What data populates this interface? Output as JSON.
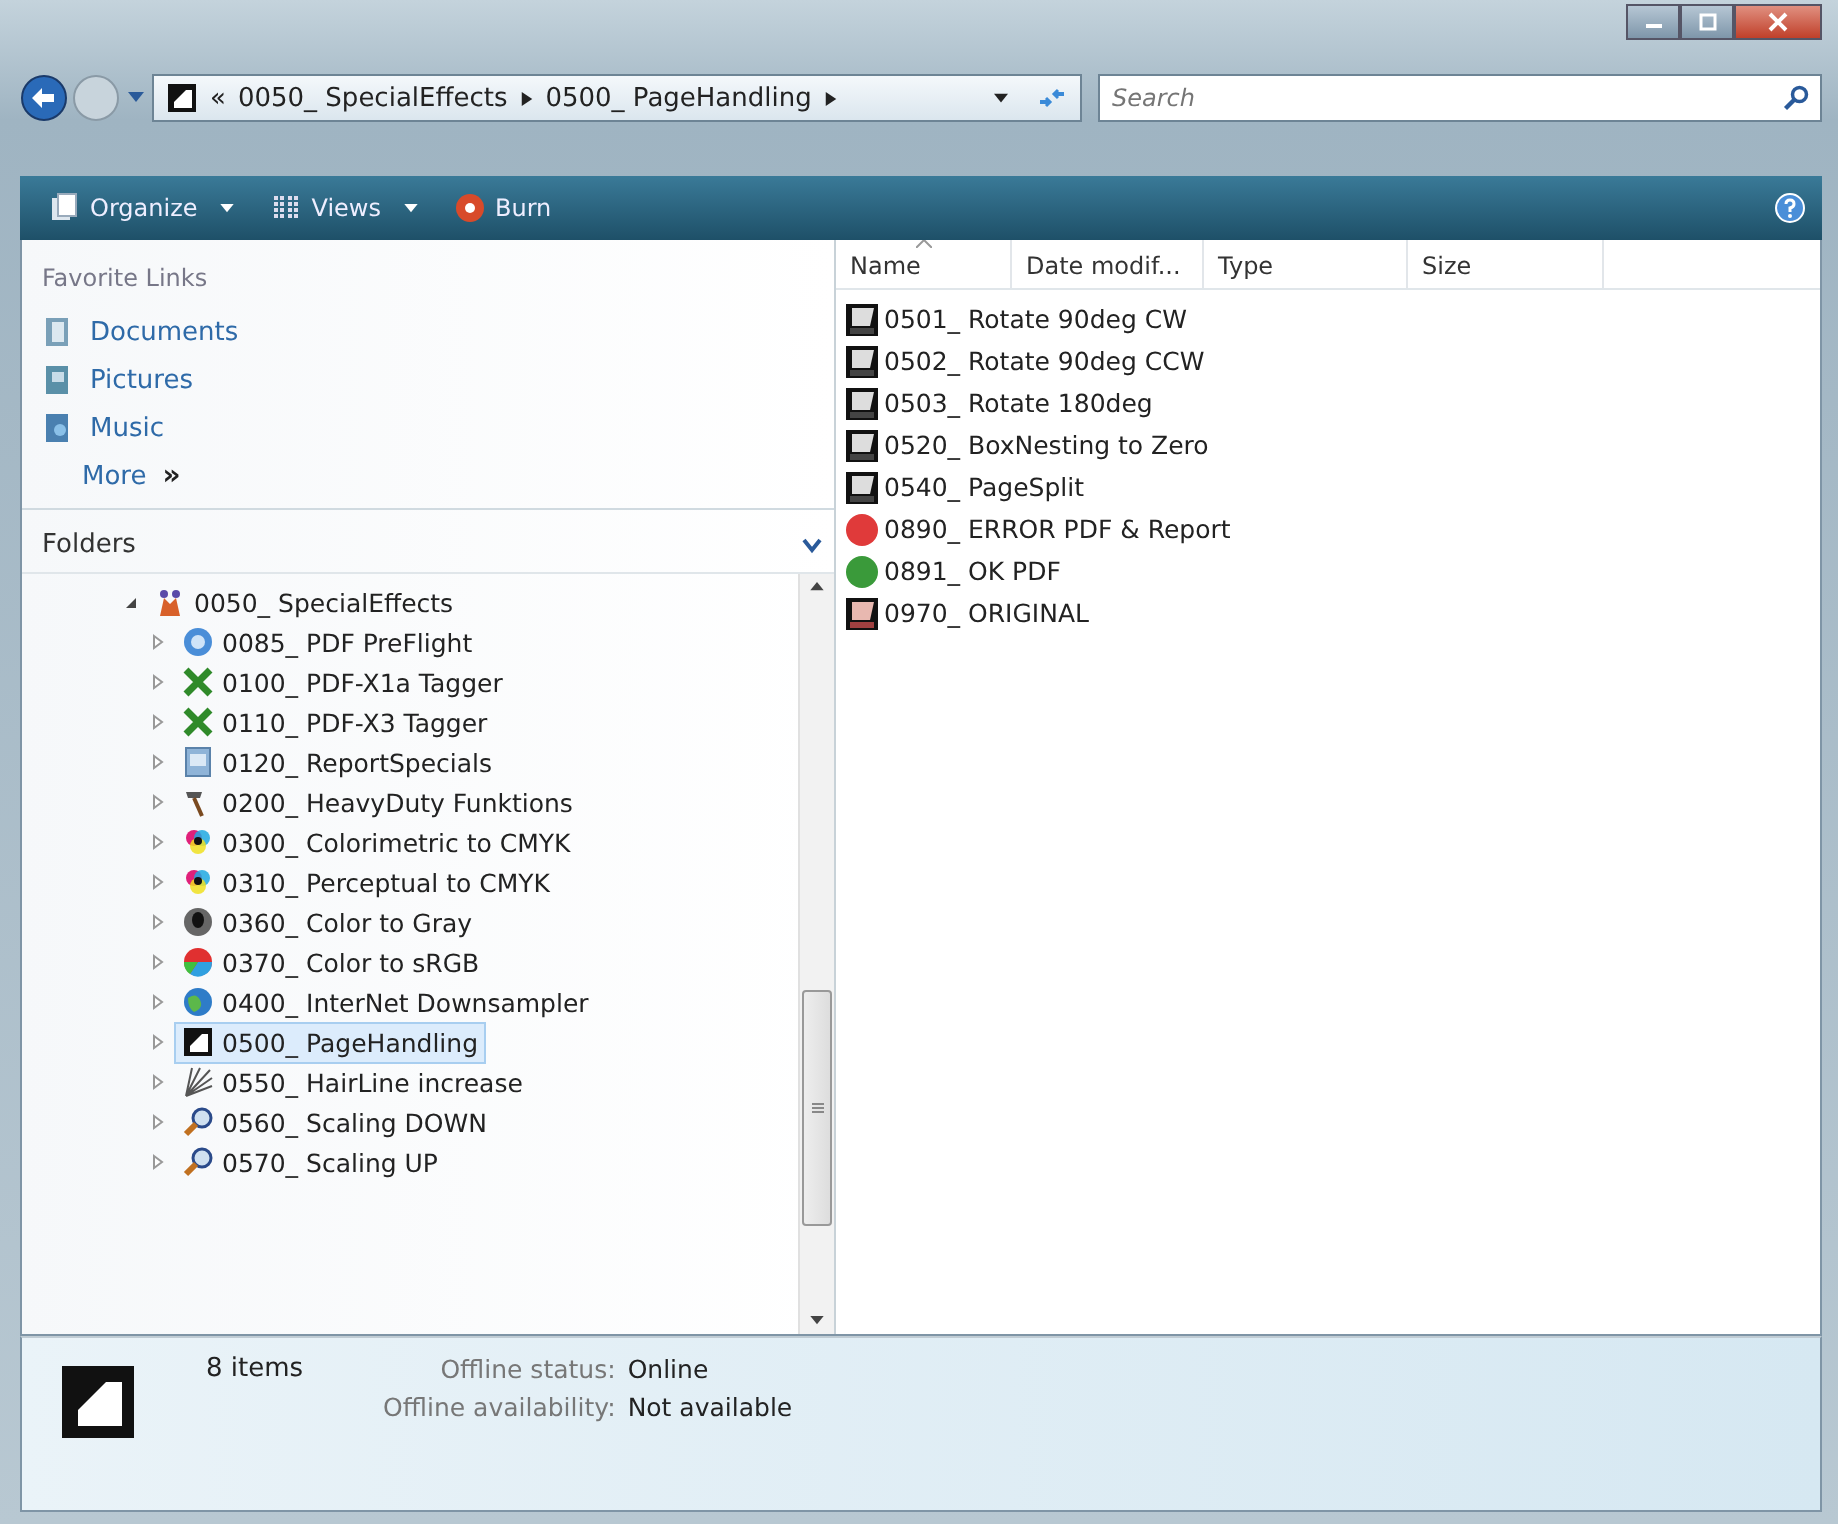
{
  "address": {
    "overflow": "«",
    "crumbs": [
      "0050_ SpecialEffects",
      "0500_ PageHandling"
    ]
  },
  "search": {
    "placeholder": "Search"
  },
  "toolbar": [
    {
      "label": "Organize",
      "kind": "organize",
      "dropdown": true
    },
    {
      "label": "Views",
      "kind": "views",
      "dropdown": true
    },
    {
      "label": "Burn",
      "kind": "burn",
      "dropdown": false
    }
  ],
  "favorite_links": {
    "title": "Favorite Links",
    "items": [
      {
        "label": "Documents",
        "kind": "documents"
      },
      {
        "label": "Pictures",
        "kind": "pictures"
      },
      {
        "label": "Music",
        "kind": "music"
      }
    ],
    "more": "More",
    "more_glyph": "»"
  },
  "folders": {
    "title": "Folders",
    "tree": [
      {
        "label": "0050_ SpecialEffects",
        "kind": "effects",
        "expanded": true,
        "selected": false,
        "children": [
          {
            "label": "0085_ PDF PreFlight",
            "kind": "preflight",
            "expanded": false,
            "selected": false
          },
          {
            "label": "0100_ PDF-X1a Tagger",
            "kind": "tagger",
            "expanded": false,
            "selected": false
          },
          {
            "label": "0110_ PDF-X3 Tagger",
            "kind": "tagger",
            "expanded": false,
            "selected": false
          },
          {
            "label": "0120_ ReportSpecials",
            "kind": "report",
            "expanded": false,
            "selected": false
          },
          {
            "label": "0200_ HeavyDuty Funktions",
            "kind": "hammer",
            "expanded": false,
            "selected": false
          },
          {
            "label": "0300_ Colorimetric to CMYK",
            "kind": "cmyk",
            "expanded": false,
            "selected": false
          },
          {
            "label": "0310_ Perceptual to CMYK",
            "kind": "cmyk",
            "expanded": false,
            "selected": false
          },
          {
            "label": "0360_ Color to Gray",
            "kind": "gray",
            "expanded": false,
            "selected": false
          },
          {
            "label": "0370_ Color to sRGB",
            "kind": "rgb",
            "expanded": false,
            "selected": false
          },
          {
            "label": "0400_ InterNet Downsampler",
            "kind": "globe",
            "expanded": false,
            "selected": false
          },
          {
            "label": "0500_ PageHandling",
            "kind": "page",
            "expanded": false,
            "selected": true
          },
          {
            "label": "0550_ HairLine increase",
            "kind": "hairline",
            "expanded": false,
            "selected": false
          },
          {
            "label": "0560_ Scaling DOWN",
            "kind": "magnifier",
            "expanded": false,
            "selected": false
          },
          {
            "label": "0570_ Scaling UP",
            "kind": "magnifier",
            "expanded": false,
            "selected": false
          }
        ]
      }
    ]
  },
  "columns": [
    {
      "label": "Name",
      "sorted": true
    },
    {
      "label": "Date modif...",
      "sorted": false
    },
    {
      "label": "Type",
      "sorted": false
    },
    {
      "label": "Size",
      "sorted": false
    }
  ],
  "files": [
    {
      "name": "0501_ Rotate 90deg CW",
      "kind": "hotfolder"
    },
    {
      "name": "0502_ Rotate 90deg CCW",
      "kind": "hotfolder"
    },
    {
      "name": "0503_ Rotate 180deg",
      "kind": "hotfolder"
    },
    {
      "name": "0520_ BoxNesting to Zero",
      "kind": "hotfolder"
    },
    {
      "name": "0540_ PageSplit",
      "kind": "hotfolder"
    },
    {
      "name": "0890_ ERROR PDF & Report",
      "kind": "error"
    },
    {
      "name": "0891_ OK PDF",
      "kind": "ok"
    },
    {
      "name": "0970_ ORIGINAL",
      "kind": "original"
    }
  ],
  "details": {
    "count": "8 items",
    "fields": [
      {
        "label": "Offline status:",
        "value": "Online"
      },
      {
        "label": "Offline availability:",
        "value": "Not available"
      }
    ]
  }
}
